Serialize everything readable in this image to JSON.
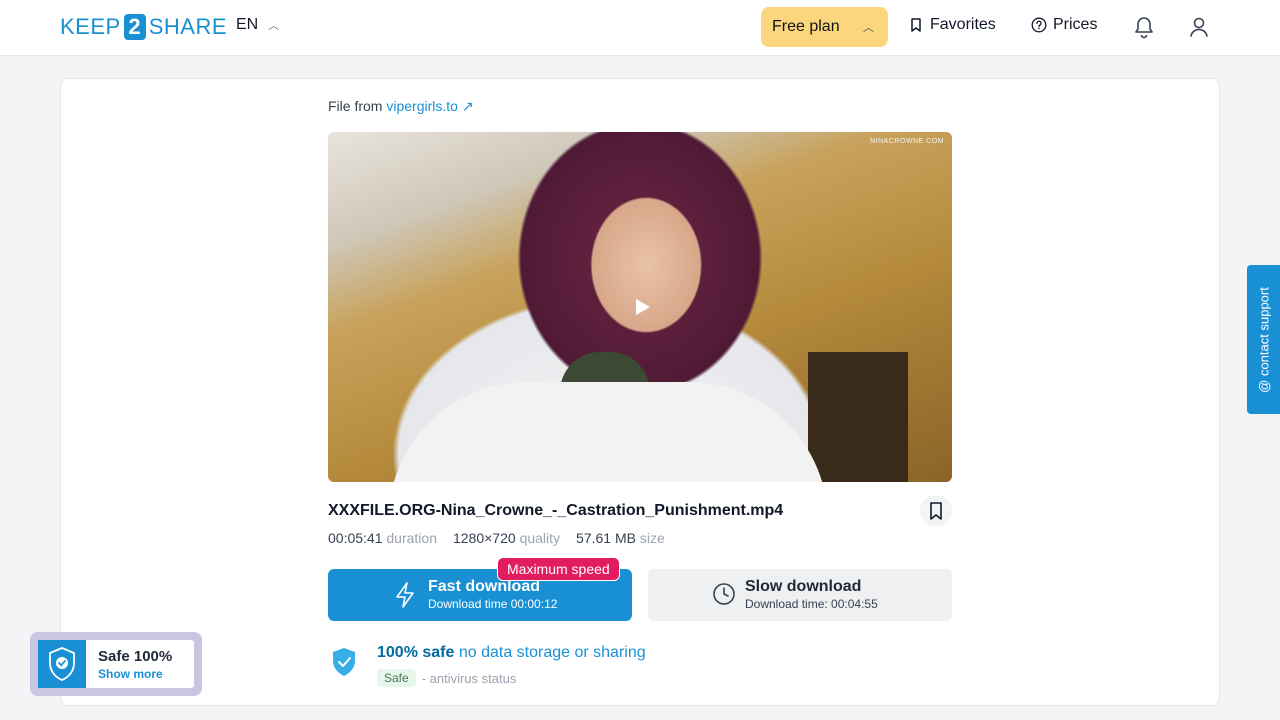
{
  "header": {
    "logo": {
      "part1": "KEEP",
      "part2": "2",
      "part3": "SHARE"
    },
    "language": "EN",
    "plan_button": "Free plan",
    "favorites": "Favorites",
    "prices": "Prices"
  },
  "file": {
    "source_prefix": "File from",
    "source_link": "vipergirls.to",
    "watermark": "NINACROWNE.COM",
    "name": "XXXFILE.ORG-Nina_Crowne_-_Castration_Punishment.mp4",
    "duration_value": "00:05:41",
    "duration_label": "duration",
    "quality_value": "1280×720",
    "quality_label": "quality",
    "size_value": "57.61 MB",
    "size_label": "size"
  },
  "download": {
    "fast_title": "Fast download",
    "fast_sub": "Download time 00:00:12",
    "max_badge": "Maximum speed",
    "slow_title": "Slow download",
    "slow_sub": "Download time: 00:04:55"
  },
  "safety": {
    "strong": "100% safe",
    "light": " no data storage or sharing",
    "tag": "Safe",
    "status": "- antivirus status"
  },
  "support": "@ contact support",
  "widget": {
    "title": "Safe 100%",
    "more": "Show more"
  },
  "colors": {
    "accent": "#1a90d4",
    "plan": "#fcd67c",
    "badge": "#e11d5f"
  }
}
